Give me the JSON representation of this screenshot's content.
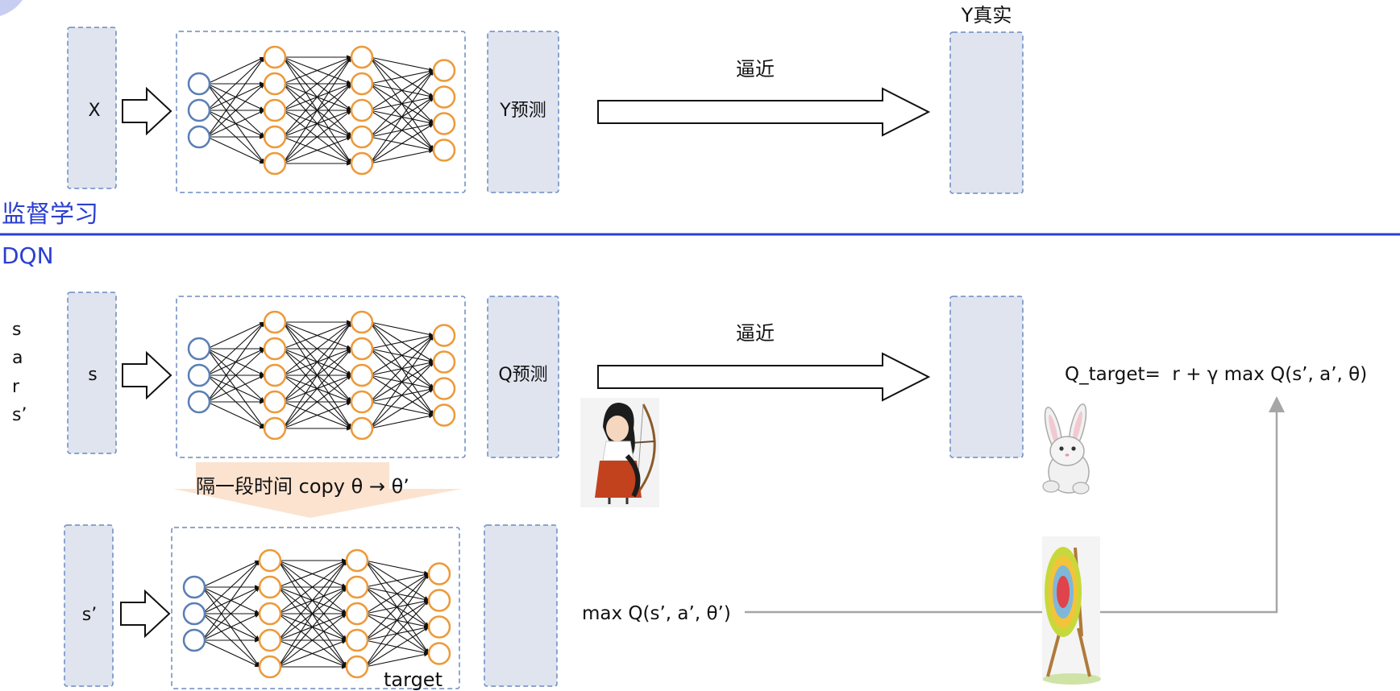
{
  "top": {
    "input_label": "X",
    "output_label": "Y预测",
    "approx_label": "逼近",
    "truth_label": "Y真实",
    "section_label": "监督学习"
  },
  "bottom": {
    "section_label": "DQN",
    "sars": [
      "s",
      "a",
      "r",
      "s’"
    ],
    "eval_input_label": "s",
    "eval_output_label": "Q预测",
    "approx_label": "逼近",
    "formula": "Q_target=  r + γ max Q(s’, a’, θ)",
    "copy_label": "隔一段时间 copy θ → θ’",
    "target_input_label": "s’",
    "target_net_label": "target",
    "maxq_label": "max Q(s’, a’, θ’)"
  },
  "colors": {
    "panel_fill": "#dfe4ef",
    "panel_border": "#6b8ac2",
    "input_node": "#5a7fb5",
    "hidden_node": "#ec9a3a",
    "divider": "#2a3fd0",
    "copy_band": "#fbe3d0",
    "feedback_line": "#a6a6a6"
  },
  "illustrations": [
    "archer-girl-icon",
    "rabbit-icon",
    "archery-target-icon"
  ]
}
